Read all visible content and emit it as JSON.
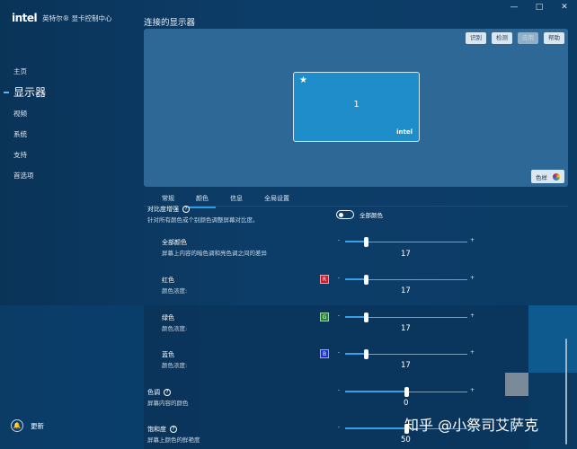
{
  "app": {
    "logo": "intel",
    "title": "英特尔® 显卡控制中心",
    "window_controls": [
      "—",
      "□",
      "✕"
    ]
  },
  "sidebar": {
    "items": [
      {
        "label": "主页",
        "active": false
      },
      {
        "label": "显示器",
        "active": true
      },
      {
        "label": "视频",
        "active": false
      },
      {
        "label": "系统",
        "active": false
      },
      {
        "label": "支持",
        "active": false
      },
      {
        "label": "首选项",
        "active": false
      }
    ],
    "update_label": "更新",
    "update_icon": "bell-icon"
  },
  "main": {
    "section_title": "连接的显示器",
    "preview_buttons": [
      {
        "label": "识别",
        "enabled": true
      },
      {
        "label": "检测",
        "enabled": true
      },
      {
        "label": "应用",
        "enabled": false
      },
      {
        "label": "帮助",
        "enabled": true
      }
    ],
    "monitor": {
      "primary_icon": "★",
      "number": "1",
      "logo": "intel"
    },
    "color_button": "色样",
    "tabs": [
      {
        "label": "常规",
        "active": false
      },
      {
        "label": "颜色",
        "active": true
      },
      {
        "label": "信息",
        "active": false
      },
      {
        "label": "全局设置",
        "active": false
      }
    ]
  },
  "color_settings": {
    "contrast": {
      "title": "对比度增强",
      "desc": "针对所有颜色或个别颜色调整屏幕对比度。",
      "toggle_label": "全部颜色"
    },
    "all_colors": {
      "title": "全部颜色",
      "desc": "屏幕上内容的暗色调和亮色调之间的差异",
      "value": 17,
      "min": 0,
      "max": 100
    },
    "red": {
      "title": "红色",
      "desc": "颜色浓度:",
      "badge": "R",
      "badge_color": "#d11a2a",
      "value": 17,
      "min": 0,
      "max": 100
    },
    "green": {
      "title": "绿色",
      "desc": "颜色浓度:",
      "badge": "G",
      "badge_color": "#1e8a2e",
      "value": 17,
      "min": 0,
      "max": 100
    },
    "blue": {
      "title": "蓝色",
      "desc": "颜色浓度:",
      "badge": "B",
      "badge_color": "#1b2fd0",
      "value": 17,
      "min": 0,
      "max": 100
    },
    "hue": {
      "title": "色调",
      "desc": "屏幕内容的颜色",
      "value": 0,
      "min": -100,
      "max": 100
    },
    "saturation": {
      "title": "饱和度",
      "desc": "屏幕上颜色的鲜艳度",
      "value": 50,
      "min": 0,
      "max": 100
    },
    "slider_minus": "-",
    "slider_plus": "+"
  },
  "watermark": "知乎 @小祭司艾萨克",
  "colors": {
    "accent": "#3a9fe6",
    "background": "#0b3a63",
    "preview": "#2d6896",
    "monitor": "#1e8dc9"
  }
}
